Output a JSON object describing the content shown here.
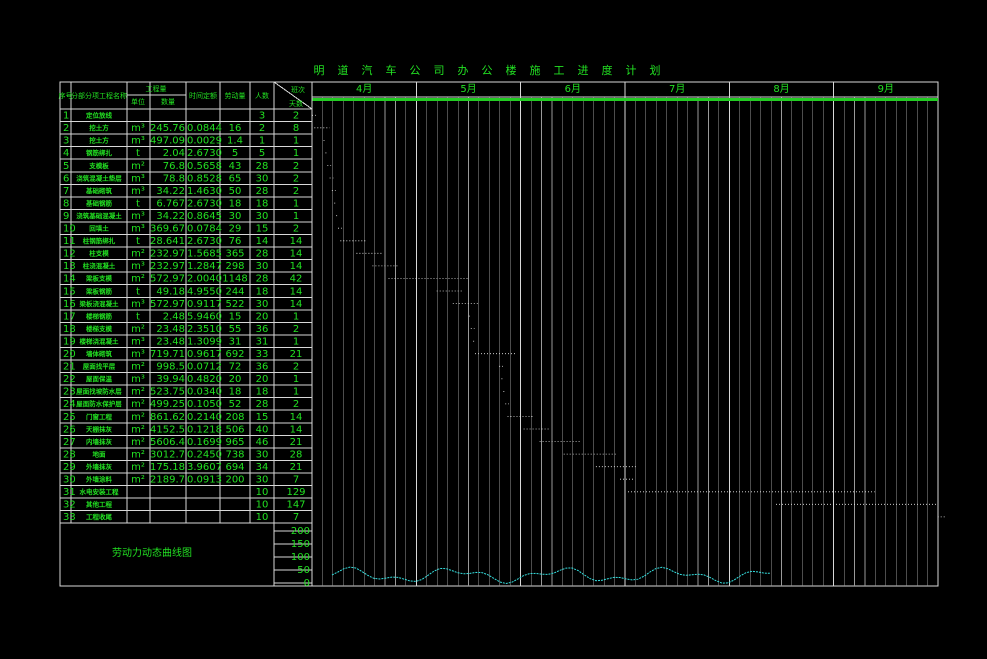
{
  "title": "明道汽车公司办公楼施工进度计划",
  "header": {
    "seq": "序号",
    "name": "分部分项工程名称",
    "qty": "工程量",
    "unit": "单位",
    "amount": "数量",
    "quota": "时间定额",
    "labor": "劳动量",
    "workers": "人数",
    "shift": "班次",
    "days": "天数"
  },
  "months": [
    "4月",
    "5月",
    "6月",
    "7月",
    "8月",
    "9月"
  ],
  "rows": [
    {
      "n": "1",
      "name": "定位放线",
      "unit": "",
      "amount": "",
      "quota": "",
      "labor": "",
      "workers": "3",
      "days": "2"
    },
    {
      "n": "2",
      "name": "挖土方",
      "unit": "m³",
      "amount": "245.76",
      "quota": "0.0844",
      "labor": "16",
      "workers": "2",
      "days": "8"
    },
    {
      "n": "3",
      "name": "挖土方",
      "unit": "m³",
      "amount": "497.09",
      "quota": "0.0029",
      "labor": "1.4",
      "workers": "1",
      "days": "1"
    },
    {
      "n": "4",
      "name": "钢筋绑扎",
      "unit": "t",
      "amount": "2.04",
      "quota": "2.6730",
      "labor": "5",
      "workers": "5",
      "days": "1"
    },
    {
      "n": "5",
      "name": "支模板",
      "unit": "m²",
      "amount": "76.8",
      "quota": "0.5658",
      "labor": "43",
      "workers": "28",
      "days": "2"
    },
    {
      "n": "6",
      "name": "浇筑混凝土垫层",
      "unit": "m³",
      "amount": "78.8",
      "quota": "0.8528",
      "labor": "65",
      "workers": "30",
      "days": "2"
    },
    {
      "n": "7",
      "name": "基础砌筑",
      "unit": "m³",
      "amount": "34.22",
      "quota": "1.4630",
      "labor": "50",
      "workers": "28",
      "days": "2"
    },
    {
      "n": "8",
      "name": "基础钢筋",
      "unit": "t",
      "amount": "6.767",
      "quota": "2.6730",
      "labor": "18",
      "workers": "18",
      "days": "1"
    },
    {
      "n": "9",
      "name": "浇筑基础混凝土",
      "unit": "m³",
      "amount": "34.22",
      "quota": "0.8645",
      "labor": "30",
      "workers": "30",
      "days": "1"
    },
    {
      "n": "10",
      "name": "回填土",
      "unit": "m³",
      "amount": "369.67",
      "quota": "0.0784",
      "labor": "29",
      "workers": "15",
      "days": "2"
    },
    {
      "n": "11",
      "name": "柱钢筋绑扎",
      "unit": "t",
      "amount": "28.641",
      "quota": "2.6730",
      "labor": "76",
      "workers": "14",
      "days": "14"
    },
    {
      "n": "12",
      "name": "柱支模",
      "unit": "m²",
      "amount": "232.97",
      "quota": "1.5685",
      "labor": "365",
      "workers": "28",
      "days": "14"
    },
    {
      "n": "13",
      "name": "柱浇混凝土",
      "unit": "m³",
      "amount": "232.97",
      "quota": "1.2847",
      "labor": "298",
      "workers": "30",
      "days": "14"
    },
    {
      "n": "14",
      "name": "梁板支模",
      "unit": "m²",
      "amount": "572.97",
      "quota": "2.0040",
      "labor": "1148",
      "workers": "28",
      "days": "42"
    },
    {
      "n": "15",
      "name": "梁板钢筋",
      "unit": "t",
      "amount": "49.18",
      "quota": "4.9550",
      "labor": "244",
      "workers": "18",
      "days": "14"
    },
    {
      "n": "16",
      "name": "梁板浇混凝土",
      "unit": "m³",
      "amount": "572.97",
      "quota": "0.9117",
      "labor": "522",
      "workers": "30",
      "days": "14"
    },
    {
      "n": "17",
      "name": "楼梯钢筋",
      "unit": "t",
      "amount": "2.48",
      "quota": "5.9460",
      "labor": "15",
      "workers": "20",
      "days": "1"
    },
    {
      "n": "18",
      "name": "楼梯支模",
      "unit": "m²",
      "amount": "23.48",
      "quota": "2.3510",
      "labor": "55",
      "workers": "36",
      "days": "2"
    },
    {
      "n": "19",
      "name": "楼梯浇混凝土",
      "unit": "m³",
      "amount": "23.48",
      "quota": "1.3099",
      "labor": "31",
      "workers": "31",
      "days": "1"
    },
    {
      "n": "20",
      "name": "墙体砌筑",
      "unit": "m³",
      "amount": "719.71",
      "quota": "0.9617",
      "labor": "692",
      "workers": "33",
      "days": "21"
    },
    {
      "n": "21",
      "name": "屋面找平层",
      "unit": "m²",
      "amount": "998.5",
      "quota": "0.0712",
      "labor": "72",
      "workers": "36",
      "days": "2"
    },
    {
      "n": "22",
      "name": "屋面保温",
      "unit": "m³",
      "amount": "39.94",
      "quota": "0.4820",
      "labor": "20",
      "workers": "20",
      "days": "1"
    },
    {
      "n": "23",
      "name": "屋面找坡防水层",
      "unit": "m²",
      "amount": "523.75",
      "quota": "0.0340",
      "labor": "18",
      "workers": "18",
      "days": "1"
    },
    {
      "n": "24",
      "name": "屋面防水保护层",
      "unit": "m²",
      "amount": "499.25",
      "quota": "0.1050",
      "labor": "52",
      "workers": "28",
      "days": "2"
    },
    {
      "n": "25",
      "name": "门窗工程",
      "unit": "m²",
      "amount": "861.62",
      "quota": "0.2140",
      "labor": "208",
      "workers": "15",
      "days": "14"
    },
    {
      "n": "26",
      "name": "天棚抹灰",
      "unit": "m²",
      "amount": "4152.5",
      "quota": "0.1218",
      "labor": "506",
      "workers": "40",
      "days": "14"
    },
    {
      "n": "27",
      "name": "内墙抹灰",
      "unit": "m²",
      "amount": "5606.4",
      "quota": "0.1699",
      "labor": "965",
      "workers": "46",
      "days": "21"
    },
    {
      "n": "28",
      "name": "地面",
      "unit": "m²",
      "amount": "3012.7",
      "quota": "0.2450",
      "labor": "738",
      "workers": "30",
      "days": "28"
    },
    {
      "n": "29",
      "name": "外墙抹灰",
      "unit": "m²",
      "amount": "175.18",
      "quota": "3.9607",
      "labor": "694",
      "workers": "34",
      "days": "21"
    },
    {
      "n": "30",
      "name": "外墙涂料",
      "unit": "m²",
      "amount": "2189.7",
      "quota": "0.0913",
      "labor": "200",
      "workers": "30",
      "days": "7"
    },
    {
      "n": "31",
      "name": "水电安装工程",
      "unit": "",
      "amount": "",
      "quota": "",
      "labor": "",
      "workers": "10",
      "days": "129"
    },
    {
      "n": "32",
      "name": "其他工程",
      "unit": "",
      "amount": "",
      "quota": "",
      "labor": "",
      "workers": "10",
      "days": "147"
    },
    {
      "n": "33",
      "name": "工程收尾",
      "unit": "",
      "amount": "",
      "quota": "",
      "labor": "",
      "workers": "10",
      "days": "7"
    }
  ],
  "labor_chart": {
    "label": "劳动力动态曲线图",
    "y_ticks": [
      "200",
      "150",
      "100",
      "50",
      "0"
    ]
  },
  "colors": {
    "text": "#22e022",
    "grid": "#d8d8d8",
    "bars": "#e8e8e8",
    "curve": "#35e0e0",
    "highlight": "#e6e640",
    "dots": "#2a8cff"
  }
}
